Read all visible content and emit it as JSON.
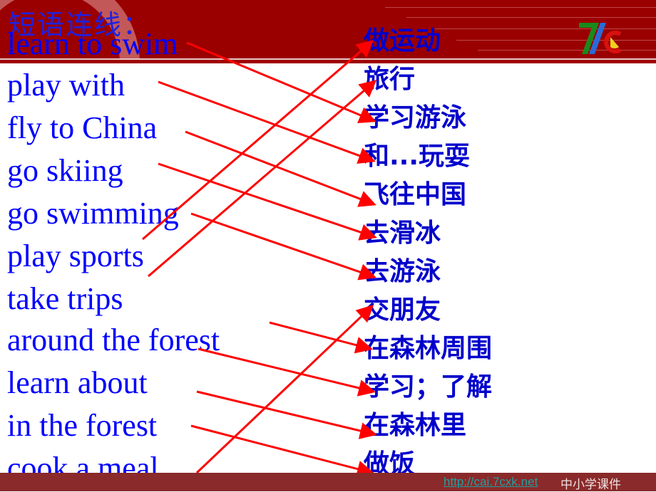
{
  "title": "短语连线：",
  "english_phrases": [
    "learn to swim",
    "play with",
    "fly to China",
    "go skiing",
    "go swimming",
    "play sports",
    "take trips",
    "around the forest",
    "learn about",
    "in the forest",
    "cook a meal"
  ],
  "chinese_phrases": [
    "做运动",
    "旅行",
    "学习游泳",
    "和...玩耍",
    "飞往中国",
    "去滑冰",
    "去游泳",
    "交朋友",
    "在森林周围",
    "学习；了解",
    "在森林里",
    "做饭"
  ],
  "matches": [
    {
      "from": 0,
      "to": 2
    },
    {
      "from": 1,
      "to": 3
    },
    {
      "from": 2,
      "to": 4
    },
    {
      "from": 3,
      "to": 5
    },
    {
      "from": 4,
      "to": 6
    },
    {
      "from": 5,
      "to": 0
    },
    {
      "from": 6,
      "to": 1
    },
    {
      "from": 7,
      "to": 8
    },
    {
      "from": 8,
      "to": 9
    },
    {
      "from": 9,
      "to": 10
    },
    {
      "from": 10,
      "to": 11
    },
    {
      "from": 10,
      "to": 7
    }
  ],
  "footer": {
    "link": "http://cai.7cxk.net",
    "text": "中小学课件"
  },
  "colors": {
    "header_bg": "#9a0000",
    "english_text": "#0000ff",
    "chinese_text": "#0000cc",
    "arrow": "#ff0000",
    "footer_bg": "#8a2a2a"
  },
  "logo": {
    "name": "7c-logo"
  }
}
